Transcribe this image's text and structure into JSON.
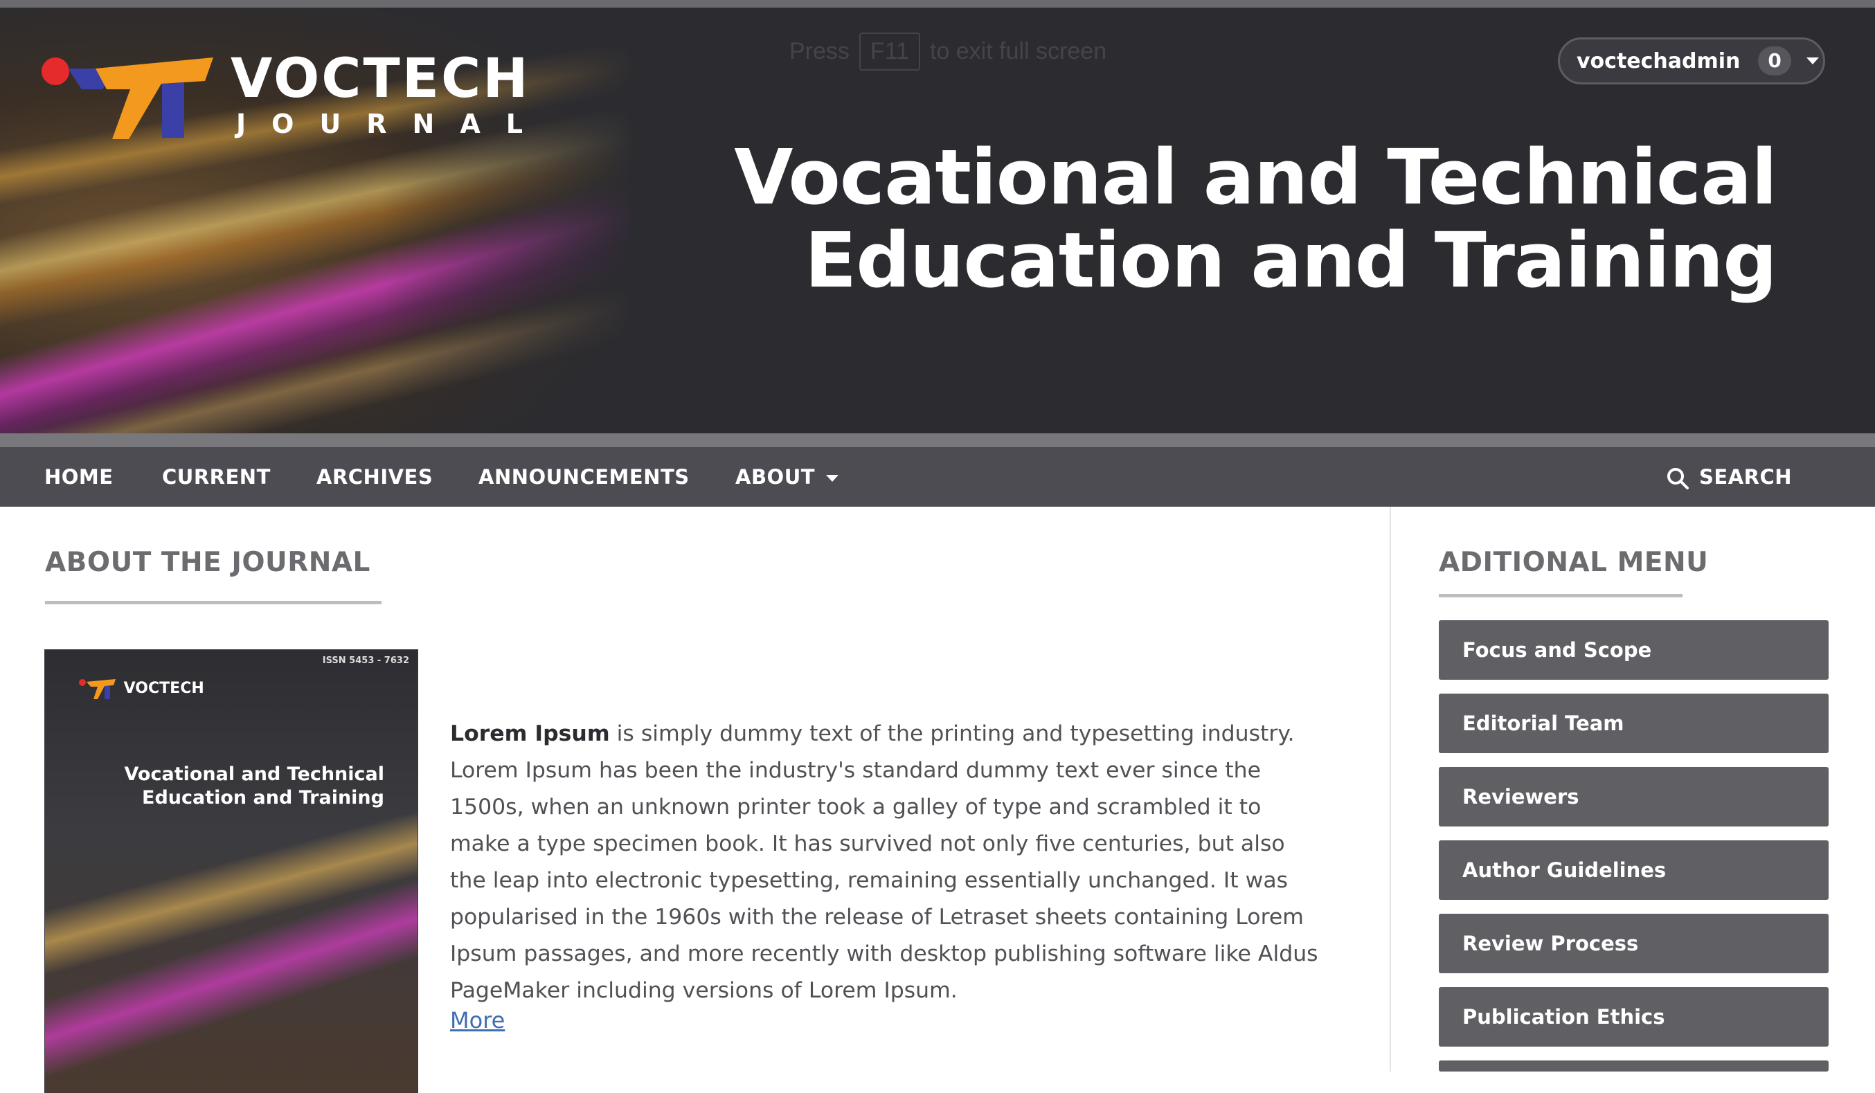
{
  "header": {
    "logo_word": "VOCTECH",
    "logo_sub": "JOURNAL",
    "fullscreen_notice": {
      "before": "Press",
      "key": "F11",
      "after": "to exit full screen"
    },
    "user": {
      "name": "voctechadmin",
      "notifications": "0"
    },
    "site_title_line1": "Vocational and Technical",
    "site_title_line2": "Education and Training"
  },
  "nav": {
    "items": [
      "HOME",
      "CURRENT",
      "ARCHIVES",
      "ANNOUNCEMENTS",
      "ABOUT"
    ],
    "search": "SEARCH"
  },
  "main": {
    "section_title": "ABOUT THE JOURNAL",
    "cover": {
      "issn": "ISSN 5453 - 7632",
      "logo": "VOCTECH",
      "title_line1": "Vocational and Technical",
      "title_line2": "Education and Training"
    },
    "intro_bold": "Lorem Ipsum",
    "intro_text": " is simply dummy text of the printing and typesetting industry. Lorem Ipsum has been the industry's standard dummy text ever since the 1500s, when an unknown printer took a galley of type and scrambled it to make a type specimen book. It has survived not only five centuries, but also the leap into electronic typesetting, remaining essentially unchanged. It was popularised in the 1960s with the release of Letraset sheets containing Lorem Ipsum passages, and more recently with desktop publishing software like Aldus PageMaker including versions of Lorem Ipsum.",
    "more_link": "More"
  },
  "sidebar": {
    "title": "ADITIONAL MENU",
    "items": [
      "Focus and Scope",
      "Editorial Team",
      "Reviewers",
      "Author Guidelines",
      "Review Process",
      "Publication Ethics"
    ]
  },
  "colors": {
    "header_bg": "#2b2b30",
    "nav_bg": "#4c4c52",
    "sidebar_button": "#5f5f64",
    "logo_orange": "#f39a1e",
    "logo_blue": "#3b3fa8",
    "logo_red": "#e52b2b",
    "link": "#3f6fb0"
  }
}
